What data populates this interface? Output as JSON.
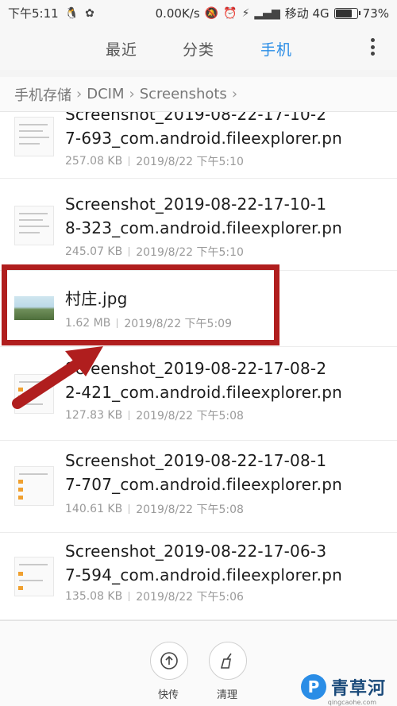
{
  "status_bar": {
    "time": "下午5:11",
    "network_speed": "0.00K/s",
    "carrier": "移动 4G",
    "battery": "73%",
    "battery_level": 0.73
  },
  "tabs": [
    {
      "label": "最近",
      "active": false
    },
    {
      "label": "分类",
      "active": false
    },
    {
      "label": "手机",
      "active": true
    }
  ],
  "breadcrumb": [
    "手机存储",
    "DCIM",
    "Screenshots"
  ],
  "files": [
    {
      "name": "Screenshot_2019-08-22-17-10-2\n7-693_com.android.fileexplorer.pn",
      "size": "257.08 KB",
      "date": "2019/8/22 下午5:10",
      "thumb": "screenshot"
    },
    {
      "name": "Screenshot_2019-08-22-17-10-1\n8-323_com.android.fileexplorer.pn",
      "size": "245.07 KB",
      "date": "2019/8/22 下午5:10",
      "thumb": "screenshot"
    },
    {
      "name": "村庄.jpg",
      "size": "1.62 MB",
      "date": "2019/8/22 下午5:09",
      "thumb": "photo"
    },
    {
      "name": "Screenshot_2019-08-22-17-08-2\n2-421_com.android.fileexplorer.pn",
      "size": "127.83 KB",
      "date": "2019/8/22 下午5:08",
      "thumb": "screenshot"
    },
    {
      "name": "Screenshot_2019-08-22-17-08-1\n7-707_com.android.fileexplorer.pn",
      "size": "140.61 KB",
      "date": "2019/8/22 下午5:08",
      "thumb": "screenshot"
    },
    {
      "name": "Screenshot_2019-08-22-17-06-3\n7-594_com.android.fileexplorer.pn",
      "size": "135.08 KB",
      "date": "2019/8/22 下午5:06",
      "thumb": "screenshot"
    }
  ],
  "bottom_bar": {
    "quick_send_label": "快传",
    "clean_label": "清理"
  },
  "watermark": {
    "logo_letter": "P",
    "text": "青草河",
    "subtext": "qingcaohe.com"
  },
  "colors": {
    "accent": "#2a8de6",
    "highlight": "#b01e1e"
  }
}
